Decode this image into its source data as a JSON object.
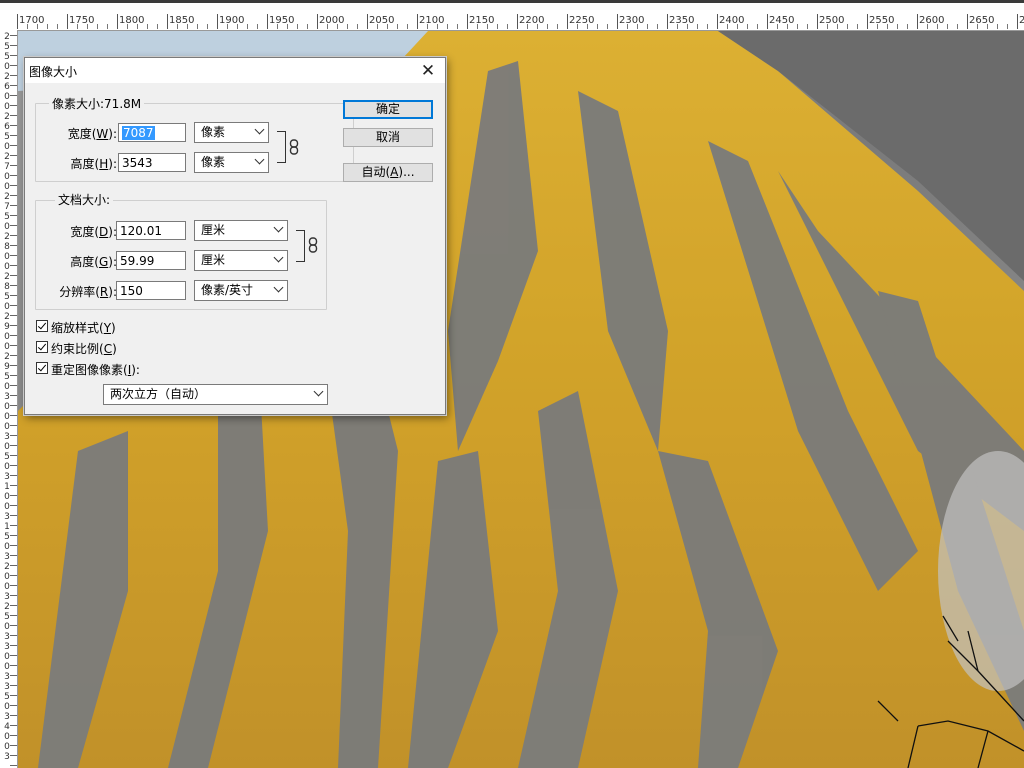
{
  "ruler": {
    "top_labels": [
      "1700",
      "1750",
      "1800",
      "1850",
      "1900",
      "1950",
      "2000",
      "2050",
      "2100",
      "2150",
      "2200",
      "2250",
      "2300",
      "2350",
      "2400",
      "2450",
      "2500",
      "2550",
      "2600",
      "2650",
      "27"
    ],
    "left_labels": [
      "2",
      "5",
      "5",
      "0",
      "2",
      "6",
      "0",
      "0",
      "2",
      "6",
      "5",
      "0",
      "2",
      "7",
      "0",
      "0",
      "2",
      "7",
      "5",
      "0",
      "2",
      "8",
      "0",
      "0",
      "2",
      "8",
      "5",
      "0",
      "2",
      "9",
      "0",
      "0",
      "2",
      "9",
      "5",
      "0",
      "3",
      "0",
      "0",
      "0",
      "3",
      "0",
      "5",
      "0",
      "3",
      "1",
      "0",
      "0",
      "3",
      "1",
      "5",
      "0",
      "3",
      "2",
      "0",
      "0",
      "3",
      "2",
      "5",
      "0",
      "3",
      "3",
      "0",
      "0",
      "3",
      "3",
      "5",
      "0",
      "3",
      "4",
      "0",
      "0",
      "3",
      "4",
      "5",
      "0",
      "3"
    ]
  },
  "dialog": {
    "title": "图像大小",
    "close_glyph": "✕",
    "pixel_group_title": "像素大小:71.8M",
    "width_label_pre": "宽度(",
    "width_key": "W",
    "width_label_post": "):",
    "width_value": "7087",
    "width_unit": "像素",
    "height_label_pre": "高度(",
    "height_key": "H",
    "height_label_post": "):",
    "height_value": "3543",
    "height_unit": "像素",
    "doc_group_title": "文档大小:",
    "doc_width_label_pre": "宽度(",
    "doc_width_key": "D",
    "doc_width_label_post": "):",
    "doc_width_value": "120.01",
    "doc_width_unit": "厘米",
    "doc_height_label_pre": "高度(",
    "doc_height_key": "G",
    "doc_height_label_post": "):",
    "doc_height_value": "59.99",
    "doc_height_unit": "厘米",
    "res_label_pre": "分辨率(",
    "res_key": "R",
    "res_label_post": "):",
    "res_value": "150",
    "res_unit": "像素/英寸",
    "ok_button": "确定",
    "cancel_button": "取消",
    "auto_button_pre": "自动(",
    "auto_key": "A",
    "auto_button_post": ")...",
    "scale_styles_pre": "缩放样式(",
    "scale_styles_key": "Y",
    "scale_styles_post": ")",
    "scale_styles_checked": true,
    "constrain_pre": "约束比例(",
    "constrain_key": "C",
    "constrain_post": ")",
    "constrain_checked": true,
    "resample_pre": "重定图像像素(",
    "resample_key": "I",
    "resample_post": "):",
    "resample_checked": true,
    "resample_method": "两次立方（自动）"
  },
  "colors": {
    "gold": "#d9ac2e",
    "rock_gray": "#8f8f8f",
    "sky": "#c3d6e5",
    "accent_blue": "#0078d7",
    "selection_blue": "#3399ff"
  }
}
